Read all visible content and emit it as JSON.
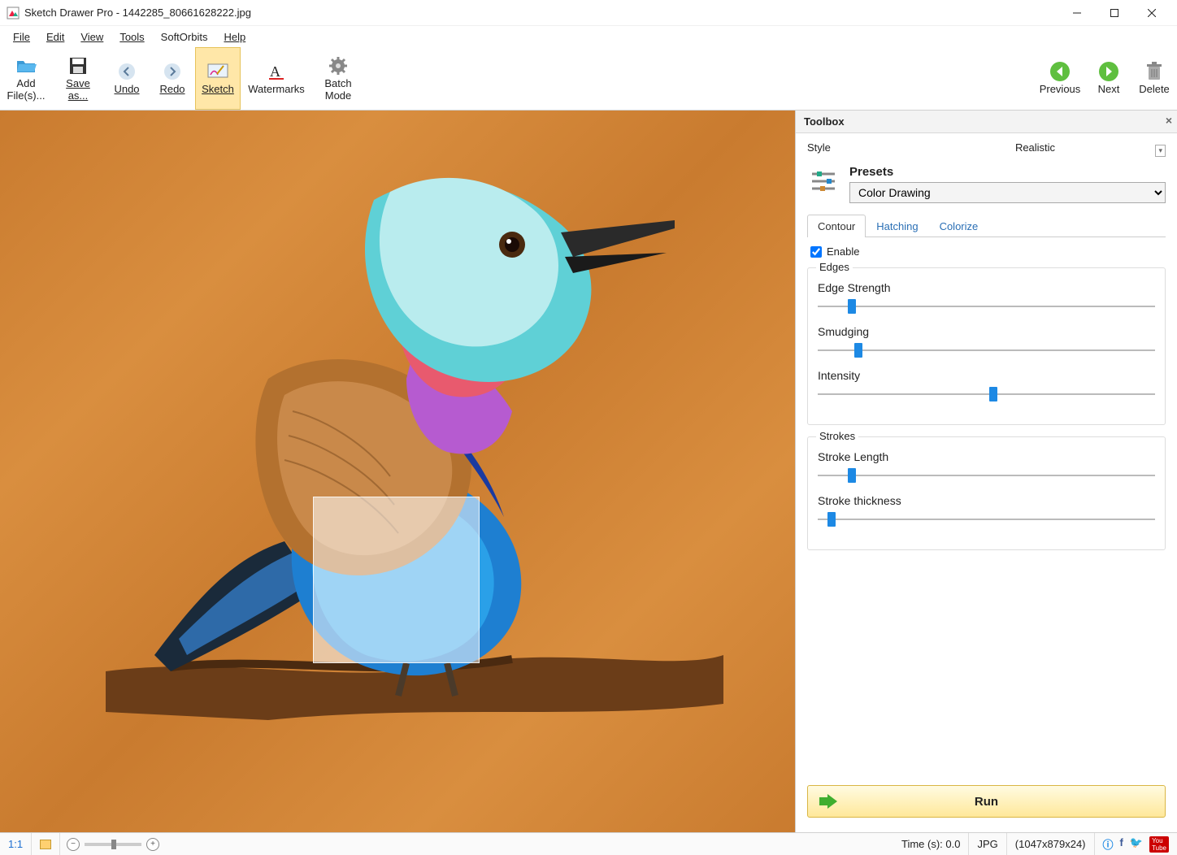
{
  "title": "Sketch Drawer Pro - 1442285_80661628222.jpg",
  "menu": {
    "file": "File",
    "edit": "Edit",
    "view": "View",
    "tools": "Tools",
    "softorbits": "SoftOrbits",
    "help": "Help"
  },
  "toolbar": {
    "addfiles": "Add\nFile(s)...",
    "saveas": "Save\nas...",
    "undo": "Undo",
    "redo": "Redo",
    "sketch": "Sketch",
    "watermarks": "Watermarks",
    "batch": "Batch\nMode",
    "previous": "Previous",
    "next": "Next",
    "delete": "Delete"
  },
  "toolbox": {
    "title": "Toolbox",
    "style_label": "Style",
    "style_value": "Realistic",
    "presets_label": "Presets",
    "presets_value": "Color Drawing",
    "tabs": {
      "contour": "Contour",
      "hatching": "Hatching",
      "colorize": "Colorize"
    },
    "enable": "Enable",
    "edges": {
      "title": "Edges",
      "edge_strength": {
        "label": "Edge Strength",
        "value": 10
      },
      "smudging": {
        "label": "Smudging",
        "value": 12
      },
      "intensity": {
        "label": "Intensity",
        "value": 52
      }
    },
    "strokes": {
      "title": "Strokes",
      "stroke_length": {
        "label": "Stroke Length",
        "value": 10
      },
      "stroke_thickness": {
        "label": "Stroke thickness",
        "value": 4
      }
    },
    "run": "Run"
  },
  "status": {
    "zoom_label": "1:1",
    "time": "Time (s): 0.0",
    "format": "JPG",
    "dims": "(1047x879x24)"
  }
}
